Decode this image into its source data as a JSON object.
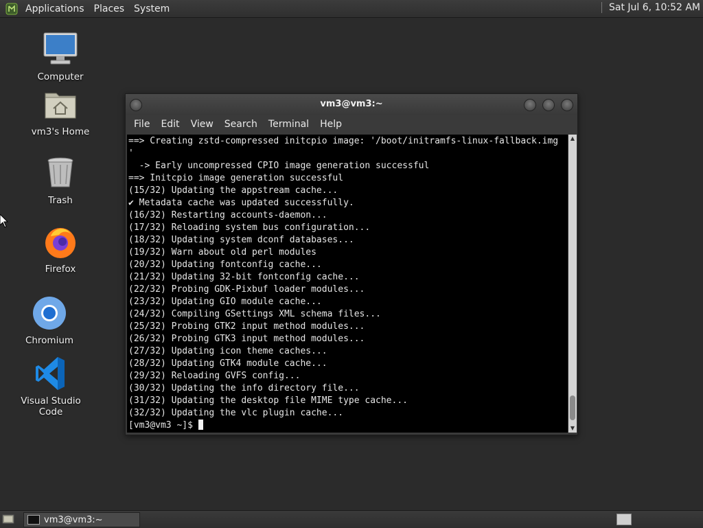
{
  "top_panel": {
    "menus": [
      "Applications",
      "Places",
      "System"
    ],
    "clock": "Sat Jul  6, 10:52 AM"
  },
  "desktop_icons": {
    "computer": "Computer",
    "home": "vm3's Home",
    "trash": "Trash",
    "firefox": "Firefox",
    "chromium": "Chromium",
    "vscode": "Visual Studio Code"
  },
  "terminal": {
    "title": "vm3@vm3:~",
    "menu": [
      "File",
      "Edit",
      "View",
      "Search",
      "Terminal",
      "Help"
    ],
    "output": "==> Creating zstd-compressed initcpio image: '/boot/initramfs-linux-fallback.img\n'\n  -> Early uncompressed CPIO image generation successful\n==> Initcpio image generation successful\n(15/32) Updating the appstream cache...\n✔ Metadata cache was updated successfully.\n(16/32) Restarting accounts-daemon...\n(17/32) Reloading system bus configuration...\n(18/32) Updating system dconf databases...\n(19/32) Warn about old perl modules\n(20/32) Updating fontconfig cache...\n(21/32) Updating 32-bit fontconfig cache...\n(22/32) Probing GDK-Pixbuf loader modules...\n(23/32) Updating GIO module cache...\n(24/32) Compiling GSettings XML schema files...\n(25/32) Probing GTK2 input method modules...\n(26/32) Probing GTK3 input method modules...\n(27/32) Updating icon theme caches...\n(28/32) Updating GTK4 module cache...\n(29/32) Reloading GVFS config...\n(30/32) Updating the info directory file...\n(31/32) Updating the desktop file MIME type cache...\n(32/32) Updating the vlc plugin cache...",
    "prompt": "[vm3@vm3 ~]$ "
  },
  "taskbar": {
    "window_label": "vm3@vm3:~"
  },
  "colors": {
    "desktop_bg": "#2b2b2b",
    "terminal_bg": "#000000",
    "terminal_fg": "#e6e6e6",
    "panel_bg": "#333333"
  }
}
